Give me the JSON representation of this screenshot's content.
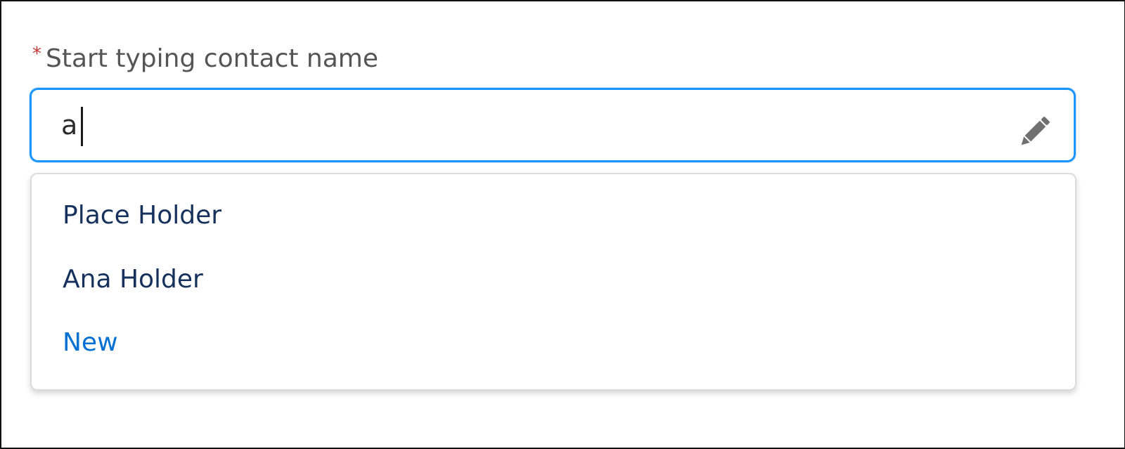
{
  "field": {
    "required_marker": "*",
    "label": "Start typing contact name",
    "value": "a",
    "edit_icon": "pencil-icon"
  },
  "dropdown": {
    "options": [
      {
        "label": "Place Holder"
      },
      {
        "label": "Ana Holder"
      },
      {
        "label": "New"
      }
    ]
  },
  "colors": {
    "focus_border": "#1b96ff",
    "required": "#c23934",
    "option_text": "#16325c",
    "link": "#0070d2"
  }
}
